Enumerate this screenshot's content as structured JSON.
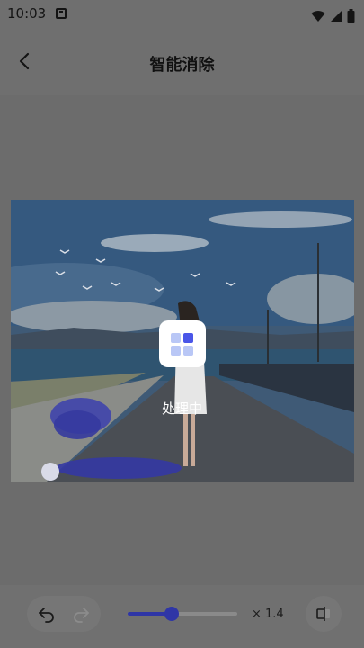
{
  "status_bar": {
    "time": "10:03",
    "icons": [
      "notification-a-icon",
      "wifi-icon",
      "signal-icon",
      "battery-icon"
    ]
  },
  "header": {
    "title": "智能消除",
    "back_icon": "chevron-left-icon"
  },
  "canvas": {
    "processing_text": "处理中",
    "loader_icon": "grid-four-squares-icon",
    "image_description_hidden": true
  },
  "toolbar": {
    "undo_icon": "undo-icon",
    "redo_icon": "redo-icon",
    "brush_size": 0.4,
    "zoom_label": "× 1.4",
    "compare_icon": "compare-icon"
  },
  "colors": {
    "accent": "#2f36a6",
    "loader_active": "#4a56e8",
    "loader_inactive": "#b9c7f6",
    "overlay": "#6f6f6f"
  }
}
